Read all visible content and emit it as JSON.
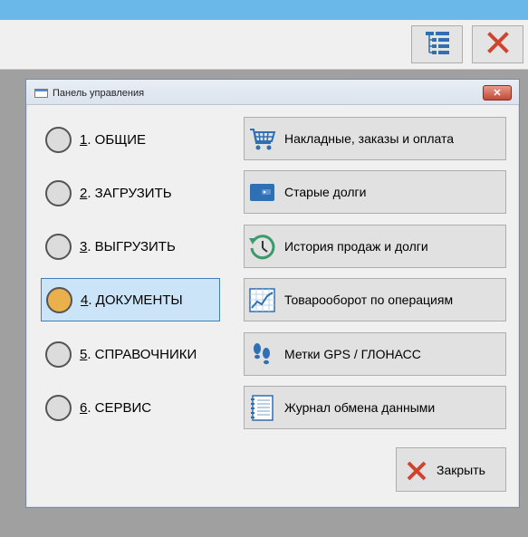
{
  "app": {
    "toolbar": {
      "menu_icon": "tree-list-icon",
      "close_icon": "close-x-icon"
    }
  },
  "dialog": {
    "title": "Панель управления",
    "radio_items": [
      {
        "num": "1",
        "label": ". ОБЩИЕ",
        "selected": false
      },
      {
        "num": "2",
        "label": ". ЗАГРУЗИТЬ",
        "selected": false
      },
      {
        "num": "3",
        "label": ". ВЫГРУЗИТЬ",
        "selected": false
      },
      {
        "num": "4",
        "label": ". ДОКУМЕНТЫ",
        "selected": true
      },
      {
        "num": "5",
        "label": ". СПРАВОЧНИКИ",
        "selected": false
      },
      {
        "num": "6",
        "label": ". СЕРВИС",
        "selected": false
      }
    ],
    "actions": [
      {
        "label": "Накладные, заказы и оплата",
        "icon": "shopping-cart-icon"
      },
      {
        "label": "Старые долги",
        "icon": "wallet-icon"
      },
      {
        "label": "История продаж и долги",
        "icon": "history-clock-icon"
      },
      {
        "label": "Товарооборот по операциям",
        "icon": "chart-icon"
      },
      {
        "label": "Метки GPS / ГЛОНАСС",
        "icon": "footprints-icon"
      },
      {
        "label": "Журнал обмена данными",
        "icon": "notebook-icon"
      }
    ],
    "close_button": {
      "label": "Закрыть",
      "icon": "close-x-icon"
    }
  },
  "colors": {
    "topbar": "#6ab8ea",
    "selected_bg": "#cce4f7",
    "selected_radio": "#e9b04b",
    "close_red": "#d0432f",
    "icon_blue": "#2f6fb3",
    "icon_green": "#3a9a6a"
  }
}
